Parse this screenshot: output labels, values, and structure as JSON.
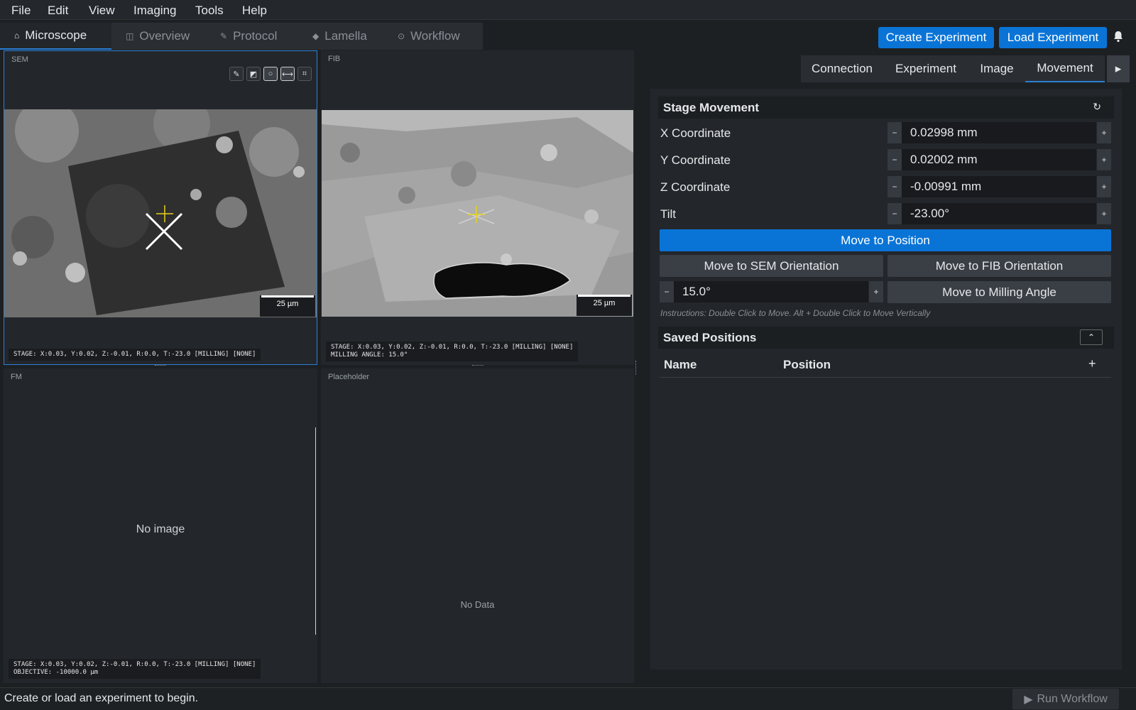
{
  "menu": {
    "items": [
      "File",
      "Edit",
      "View",
      "Imaging",
      "Tools",
      "Help"
    ]
  },
  "tabs": [
    {
      "label": "Microscope",
      "icon": "microscope-icon",
      "glyph": "⌂"
    },
    {
      "label": "Overview",
      "icon": "map-icon",
      "glyph": "◫"
    },
    {
      "label": "Protocol",
      "icon": "document-icon",
      "glyph": "✎"
    },
    {
      "label": "Lamella",
      "icon": "layers-icon",
      "glyph": "◆"
    },
    {
      "label": "Workflow",
      "icon": "play-circle-icon",
      "glyph": "⊙"
    }
  ],
  "header": {
    "create_label": "Create Experiment",
    "load_label": "Load Experiment"
  },
  "viewers": {
    "sem": {
      "label": "SEM",
      "scale": "25 µm",
      "status": "STAGE: X:0.03, Y:0.02, Z:-0.01, R:0.0, T:-23.0 [MILLING] [NONE]"
    },
    "fib": {
      "label": "FIB",
      "scale": "25 µm",
      "status1": "STAGE: X:0.03, Y:0.02, Z:-0.01, R:0.0, T:-23.0 [MILLING] [NONE]",
      "status2": "MILLING ANGLE: 15.0°"
    },
    "fm": {
      "label": "FM",
      "empty": "No image",
      "status1": "STAGE: X:0.03, Y:0.02, Z:-0.01, R:0.0, T:-23.0 [MILLING] [NONE]",
      "status2": "OBJECTIVE: -10000.0 µm"
    },
    "placeholder": {
      "label": "Placeholder",
      "empty": "No Data"
    }
  },
  "right_tabs": [
    "Connection",
    "Experiment",
    "Image",
    "Movement"
  ],
  "stage": {
    "title": "Stage Movement",
    "x_label": "X Coordinate",
    "x_value": "0.02998 mm",
    "y_label": "Y Coordinate",
    "y_value": "0.02002 mm",
    "z_label": "Z Coordinate",
    "z_value": "-0.00991 mm",
    "tilt_label": "Tilt",
    "tilt_value": "-23.00°",
    "move_position": "Move to Position",
    "move_sem": "Move to SEM Orientation",
    "move_fib": "Move to FIB Orientation",
    "milling_angle_value": "15.0°",
    "move_milling": "Move to Milling Angle",
    "instructions": "Instructions: Double Click to Move. Alt + Double Click to Move Vertically"
  },
  "saved": {
    "title": "Saved Positions",
    "col_name": "Name",
    "col_position": "Position"
  },
  "status": {
    "message": "Create or load an experiment to begin.",
    "run_label": "Run Workflow"
  },
  "colors": {
    "accent": "#0a74d6",
    "background": "#1d2023",
    "panel": "#23272b"
  }
}
